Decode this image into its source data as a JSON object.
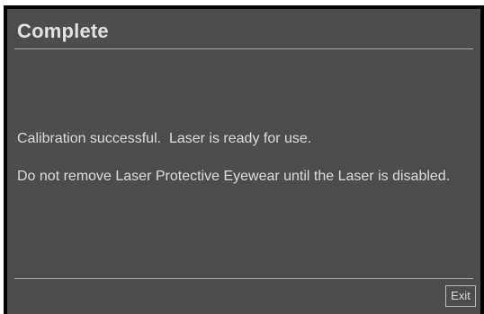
{
  "dialog": {
    "title": "Complete",
    "message_1": "Calibration successful.  Laser is ready for use.",
    "message_2": "Do not remove Laser Protective Eyewear until the Laser is disabled.",
    "exit_label": "Exit"
  },
  "colors": {
    "background": "#4d4d4d",
    "frame": "#000000",
    "text": "#dcdcdc",
    "divider": "#a8a8a8"
  }
}
